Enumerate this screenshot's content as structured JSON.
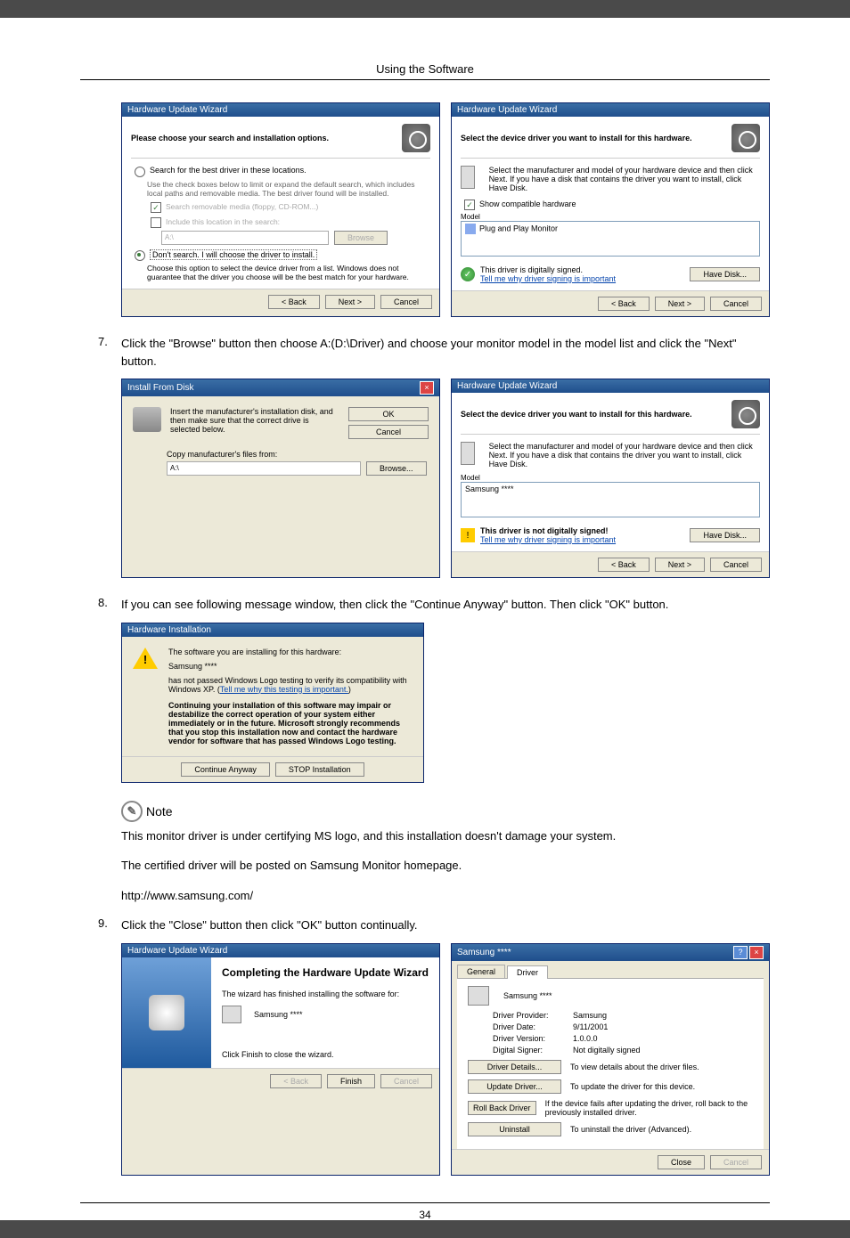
{
  "header": "Using the Software",
  "page_number": "34",
  "step7": {
    "num": "7.",
    "text": "Click the \"Browse\" button then choose A:(D:\\Driver) and choose your monitor model in the model list and click the \"Next\" button."
  },
  "step8": {
    "num": "8.",
    "text": "If you can see following message window, then click the \"Continue Anyway\" button. Then click \"OK\" button."
  },
  "step9": {
    "num": "9.",
    "text": "Click the \"Close\" button then click \"OK\" button continually."
  },
  "note_label": "Note",
  "note_para1": "This monitor driver is under certifying MS logo, and this installation doesn't damage your system.",
  "note_para2": "The certified driver will be posted on Samsung Monitor homepage.",
  "note_url": "http://www.samsung.com/",
  "wiz_a": {
    "title": "Hardware Update Wizard",
    "head": "Please choose your search and installation options.",
    "r1": "Search for the best driver in these locations.",
    "r1_desc": "Use the check boxes below to limit or expand the default search, which includes local paths and removable media. The best driver found will be installed.",
    "c1": "Search removable media (floppy, CD-ROM...)",
    "c2": "Include this location in the search:",
    "path_val": "A:\\",
    "browse": "Browse",
    "r2": "Don't search. I will choose the driver to install.",
    "r2_desc": "Choose this option to select the device driver from a list. Windows does not guarantee that the driver you choose will be the best match for your hardware.",
    "back": "< Back",
    "next": "Next >",
    "cancel": "Cancel"
  },
  "wiz_b": {
    "title": "Hardware Update Wizard",
    "head": "Select the device driver you want to install for this hardware.",
    "desc": "Select the manufacturer and model of your hardware device and then click Next. If you have a disk that contains the driver you want to install, click Have Disk.",
    "show_compat": "Show compatible hardware",
    "model_label": "Model",
    "model_item": "Plug and Play Monitor",
    "sig_text": "This driver is digitally signed.",
    "sig_link": "Tell me why driver signing is important",
    "have_disk": "Have Disk...",
    "back": "< Back",
    "next": "Next >",
    "cancel": "Cancel"
  },
  "ifd": {
    "title": "Install From Disk",
    "text": "Insert the manufacturer's installation disk, and then make sure that the correct drive is selected below.",
    "ok": "OK",
    "cancel": "Cancel",
    "copy_label": "Copy manufacturer's files from:",
    "path": "A:\\",
    "browse": "Browse..."
  },
  "wiz_c": {
    "title": "Hardware Update Wizard",
    "head": "Select the device driver you want to install for this hardware.",
    "desc": "Select the manufacturer and model of your hardware device and then click Next. If you have a disk that contains the driver you want to install, click Have Disk.",
    "model_label": "Model",
    "model_item": "Samsung ****",
    "sig_text": "This driver is not digitally signed!",
    "sig_link": "Tell me why driver signing is important",
    "have_disk": "Have Disk...",
    "back": "< Back",
    "next": "Next >",
    "cancel": "Cancel"
  },
  "hw_install": {
    "title": "Hardware Installation",
    "line1": "The software you are installing for this hardware:",
    "line2": "Samsung ****",
    "line3a": "has not passed Windows Logo testing to verify its compatibility with Windows XP. (",
    "line3b": "Tell me why this testing is important.",
    "line3c": ")",
    "bold": "Continuing your installation of this software may impair or destabilize the correct operation of your system either immediately or in the future. Microsoft strongly recommends that you stop this installation now and contact the hardware vendor for software that has passed Windows Logo testing.",
    "cont": "Continue Anyway",
    "stop": "STOP Installation"
  },
  "wiz_done": {
    "title": "Hardware Update Wizard",
    "head": "Completing the Hardware Update Wizard",
    "text1": "The wizard has finished installing the software for:",
    "device": "Samsung ****",
    "text2": "Click Finish to close the wizard.",
    "back": "< Back",
    "finish": "Finish",
    "cancel": "Cancel"
  },
  "props": {
    "title": "Samsung ****",
    "tab_general": "General",
    "tab_driver": "Driver",
    "device": "Samsung ****",
    "provider_k": "Driver Provider:",
    "provider_v": "Samsung",
    "date_k": "Driver Date:",
    "date_v": "9/11/2001",
    "version_k": "Driver Version:",
    "version_v": "1.0.0.0",
    "signer_k": "Digital Signer:",
    "signer_v": "Not digitally signed",
    "details_btn": "Driver Details...",
    "details_txt": "To view details about the driver files.",
    "update_btn": "Update Driver...",
    "update_txt": "To update the driver for this device.",
    "rollback_btn": "Roll Back Driver",
    "rollback_txt": "If the device fails after updating the driver, roll back to the previously installed driver.",
    "uninstall_btn": "Uninstall",
    "uninstall_txt": "To uninstall the driver (Advanced).",
    "close": "Close",
    "cancel": "Cancel"
  }
}
